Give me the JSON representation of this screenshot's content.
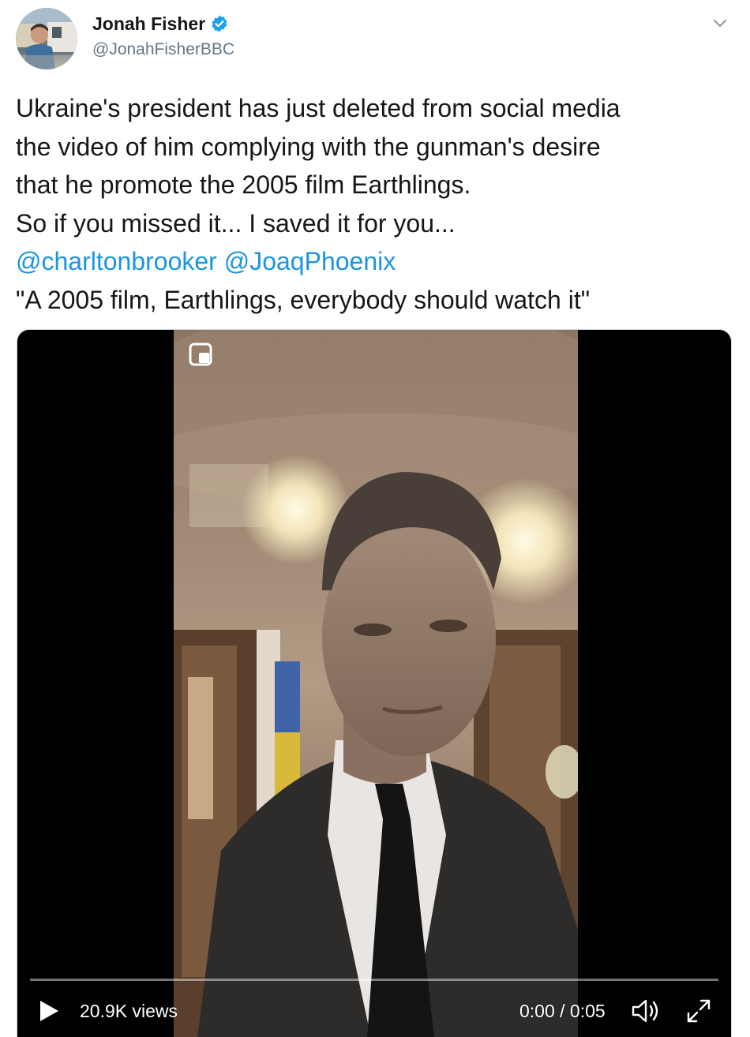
{
  "author": {
    "name": "Jonah Fisher",
    "handle": "@JonahFisherBBC",
    "verified_icon": "verified-badge-icon",
    "avatar_icon": "avatar"
  },
  "menu": {
    "icon": "chevron-down-icon"
  },
  "tweet": {
    "lines": [
      "Ukraine's president has just deleted from social media",
      "the video of him complying with the gunman's desire",
      "that he promote the 2005 film Earthlings.",
      "So if you missed it... I saved it for you..."
    ],
    "mentions": [
      "@charltonbrooker",
      "@JoaqPhoenix"
    ],
    "quote": "\"A 2005 film, Earthlings, everybody should watch it\""
  },
  "video": {
    "views": "20.9K views",
    "time": "0:00 / 0:05",
    "progress": 0.0
  },
  "colors": {
    "link": "#1b95e0",
    "verified": "#1da1f2",
    "muted": "#657786"
  }
}
